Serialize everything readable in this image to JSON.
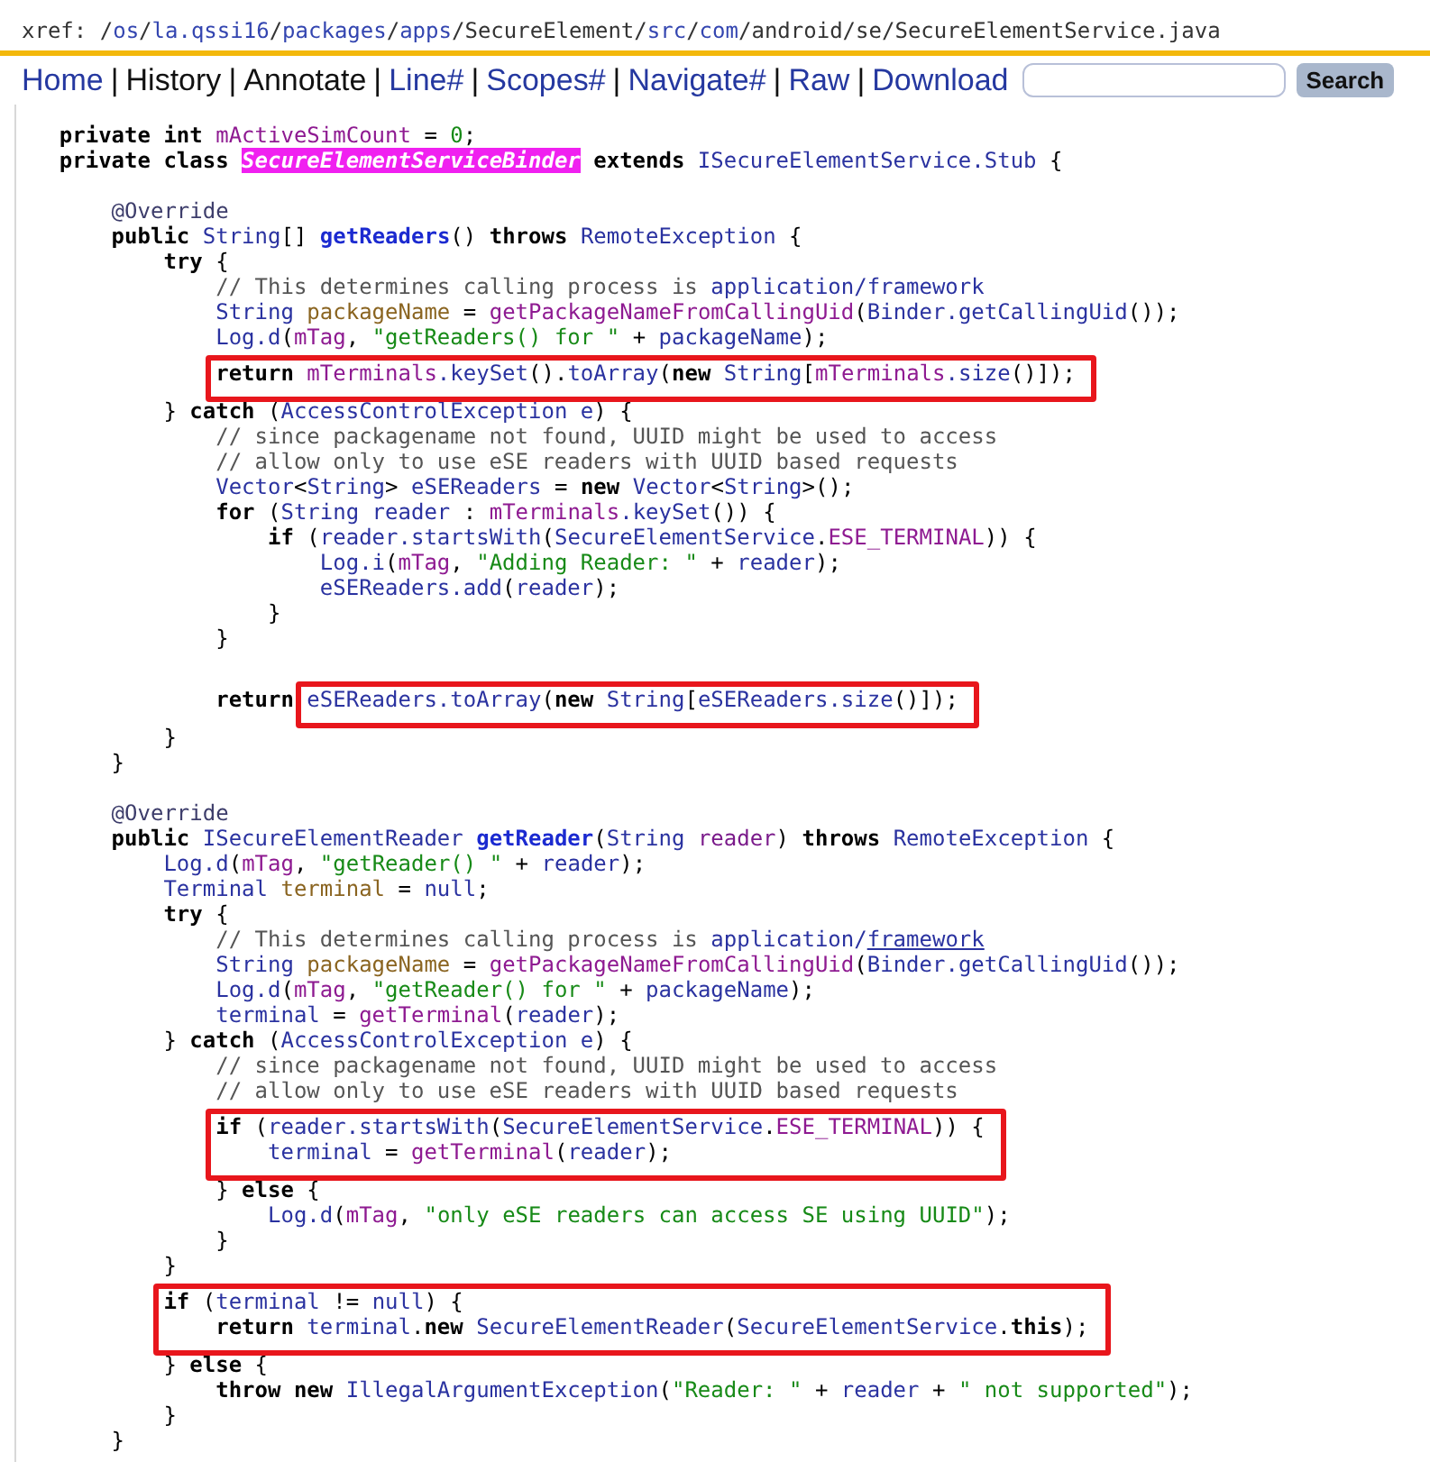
{
  "xref": {
    "label": "xref:",
    "separator": "/",
    "segments": [
      {
        "text": "os",
        "visited": false
      },
      {
        "text": "la.qssi16",
        "visited": false
      },
      {
        "text": "packages",
        "visited": false
      },
      {
        "text": "apps",
        "visited": false
      },
      {
        "text": "SecureElement",
        "visited": true
      },
      {
        "text": "src",
        "visited": false
      },
      {
        "text": "com",
        "visited": false
      },
      {
        "text": "android",
        "visited": true
      },
      {
        "text": "se",
        "visited": true
      },
      {
        "text": "SecureElementService.java",
        "visited": true
      }
    ]
  },
  "nav": {
    "separator": "|",
    "items": [
      {
        "label": "Home",
        "visited": false
      },
      {
        "label": "History",
        "visited": true
      },
      {
        "label": "Annotate",
        "visited": true
      },
      {
        "label": "Line#",
        "visited": false
      },
      {
        "label": "Scopes#",
        "visited": false
      },
      {
        "label": "Navigate#",
        "visited": false
      },
      {
        "label": "Raw",
        "visited": false
      },
      {
        "label": "Download",
        "visited": false
      }
    ],
    "search_button": "Search"
  },
  "code_lines": [
    {
      "kind": "code",
      "tokens": [
        {
          "kind": "kw",
          "t": "    private int "
        },
        {
          "kind": "fld",
          "t": "mActiveSimCount"
        },
        {
          "kind": "p",
          "t": " = "
        },
        {
          "kind": "num",
          "t": "0"
        },
        {
          "kind": "p",
          "t": ";"
        }
      ]
    },
    {
      "kind": "code",
      "tokens": [
        {
          "kind": "kw",
          "t": "    private class "
        },
        {
          "kind": "hl",
          "t": "SecureElementServiceBinder"
        },
        {
          "kind": "kw",
          "t": " extends "
        },
        {
          "kind": "id",
          "t": "ISecureElementService.Stub"
        },
        {
          "kind": "p",
          "t": " {"
        }
      ]
    },
    {
      "kind": "blank"
    },
    {
      "kind": "code",
      "tokens": [
        {
          "kind": "ann",
          "t": "        @Override"
        }
      ]
    },
    {
      "kind": "code",
      "tokens": [
        {
          "kind": "kw",
          "t": "        public "
        },
        {
          "kind": "id",
          "t": "String"
        },
        {
          "kind": "p",
          "t": "[] "
        },
        {
          "kind": "def",
          "t": "getReaders"
        },
        {
          "kind": "p",
          "t": "() "
        },
        {
          "kind": "kw",
          "t": "throws "
        },
        {
          "kind": "id",
          "t": "RemoteException"
        },
        {
          "kind": "p",
          "t": " {"
        }
      ]
    },
    {
      "kind": "code",
      "tokens": [
        {
          "kind": "kw",
          "t": "            try"
        },
        {
          "kind": "p",
          "t": " {"
        }
      ]
    },
    {
      "kind": "code",
      "tokens": [
        {
          "kind": "com",
          "t": "                // This determines calling process is "
        },
        {
          "kind": "ref",
          "t": "application/framework"
        }
      ]
    },
    {
      "kind": "code",
      "tokens": [
        {
          "kind": "id",
          "t": "                String "
        },
        {
          "kind": "loc",
          "t": "packageName"
        },
        {
          "kind": "p",
          "t": " = "
        },
        {
          "kind": "fld",
          "t": "getPackageNameFromCallingUid"
        },
        {
          "kind": "p",
          "t": "("
        },
        {
          "kind": "id",
          "t": "Binder.getCallingUid"
        },
        {
          "kind": "p",
          "t": "());"
        }
      ]
    },
    {
      "kind": "code",
      "tokens": [
        {
          "kind": "id",
          "t": "                Log.d"
        },
        {
          "kind": "p",
          "t": "("
        },
        {
          "kind": "fld",
          "t": "mTag"
        },
        {
          "kind": "p",
          "t": ", "
        },
        {
          "kind": "str",
          "t": "\"getReaders() for \""
        },
        {
          "kind": "p",
          "t": " + "
        },
        {
          "kind": "id",
          "t": "packageName"
        },
        {
          "kind": "p",
          "t": ");"
        }
      ]
    },
    {
      "kind": "code",
      "boxed": true,
      "tokens": [
        {
          "kind": "kw",
          "t": "                return "
        },
        {
          "kind": "fld",
          "t": "mTerminals"
        },
        {
          "kind": "id",
          "t": ".keySet"
        },
        {
          "kind": "p",
          "t": "()."
        },
        {
          "kind": "id",
          "t": "toArray"
        },
        {
          "kind": "p",
          "t": "("
        },
        {
          "kind": "kw",
          "t": "new "
        },
        {
          "kind": "id",
          "t": "String"
        },
        {
          "kind": "p",
          "t": "["
        },
        {
          "kind": "fld",
          "t": "mTerminals"
        },
        {
          "kind": "id",
          "t": ".size"
        },
        {
          "kind": "p",
          "t": "()]);"
        }
      ]
    },
    {
      "kind": "code",
      "tokens": [
        {
          "kind": "p",
          "t": "            } "
        },
        {
          "kind": "kw",
          "t": "catch"
        },
        {
          "kind": "p",
          "t": " ("
        },
        {
          "kind": "id",
          "t": "AccessControlException e"
        },
        {
          "kind": "p",
          "t": ") {"
        }
      ]
    },
    {
      "kind": "code",
      "tokens": [
        {
          "kind": "com",
          "t": "                // since packagename not found, UUID might be used to access"
        }
      ]
    },
    {
      "kind": "code",
      "tokens": [
        {
          "kind": "com",
          "t": "                // allow only to use eSE readers with UUID based requests"
        }
      ]
    },
    {
      "kind": "code",
      "tokens": [
        {
          "kind": "id",
          "t": "                Vector"
        },
        {
          "kind": "p",
          "t": "<"
        },
        {
          "kind": "id",
          "t": "String"
        },
        {
          "kind": "p",
          "t": "> "
        },
        {
          "kind": "id",
          "t": "eSEReaders"
        },
        {
          "kind": "p",
          "t": " = "
        },
        {
          "kind": "kw",
          "t": "new "
        },
        {
          "kind": "id",
          "t": "Vector"
        },
        {
          "kind": "p",
          "t": "<"
        },
        {
          "kind": "id",
          "t": "String"
        },
        {
          "kind": "p",
          "t": ">();"
        }
      ]
    },
    {
      "kind": "code",
      "tokens": [
        {
          "kind": "kw",
          "t": "                for"
        },
        {
          "kind": "p",
          "t": " ("
        },
        {
          "kind": "id",
          "t": "String reader"
        },
        {
          "kind": "p",
          "t": " : "
        },
        {
          "kind": "fld",
          "t": "mTerminals"
        },
        {
          "kind": "id",
          "t": ".keySet"
        },
        {
          "kind": "p",
          "t": "()) {"
        }
      ]
    },
    {
      "kind": "code",
      "tokens": [
        {
          "kind": "kw",
          "t": "                    if"
        },
        {
          "kind": "p",
          "t": " ("
        },
        {
          "kind": "id",
          "t": "reader.startsWith"
        },
        {
          "kind": "p",
          "t": "("
        },
        {
          "kind": "id",
          "t": "SecureElementService"
        },
        {
          "kind": "p",
          "t": "."
        },
        {
          "kind": "fld",
          "t": "ESE_TERMINAL"
        },
        {
          "kind": "p",
          "t": ")) {"
        }
      ]
    },
    {
      "kind": "code",
      "tokens": [
        {
          "kind": "id",
          "t": "                        Log.i"
        },
        {
          "kind": "p",
          "t": "("
        },
        {
          "kind": "fld",
          "t": "mTag"
        },
        {
          "kind": "p",
          "t": ", "
        },
        {
          "kind": "str",
          "t": "\"Adding Reader: \""
        },
        {
          "kind": "p",
          "t": " + "
        },
        {
          "kind": "id",
          "t": "reader"
        },
        {
          "kind": "p",
          "t": ");"
        }
      ]
    },
    {
      "kind": "code",
      "tokens": [
        {
          "kind": "id",
          "t": "                        eSEReaders.add"
        },
        {
          "kind": "p",
          "t": "("
        },
        {
          "kind": "id",
          "t": "reader"
        },
        {
          "kind": "p",
          "t": ");"
        }
      ]
    },
    {
      "kind": "code",
      "tokens": [
        {
          "kind": "p",
          "t": "                    }"
        }
      ]
    },
    {
      "kind": "code",
      "tokens": [
        {
          "kind": "p",
          "t": "                }"
        }
      ]
    },
    {
      "kind": "blank"
    },
    {
      "kind": "code",
      "boxed": true,
      "tokens": [
        {
          "kind": "kw",
          "t": "                return "
        },
        {
          "kind": "id",
          "t": "eSEReaders.toArray",
          "box_edge": true
        },
        {
          "kind": "p",
          "t": "("
        },
        {
          "kind": "kw",
          "t": "new "
        },
        {
          "kind": "id",
          "t": "String"
        },
        {
          "kind": "p",
          "t": "["
        },
        {
          "kind": "id",
          "t": "eSEReaders.size"
        },
        {
          "kind": "p",
          "t": "()]);"
        }
      ]
    },
    {
      "kind": "code",
      "tokens": [
        {
          "kind": "p",
          "t": "            }"
        }
      ]
    },
    {
      "kind": "code",
      "tokens": [
        {
          "kind": "p",
          "t": "        }"
        }
      ]
    },
    {
      "kind": "blank"
    },
    {
      "kind": "code",
      "tokens": [
        {
          "kind": "ann",
          "t": "        @Override"
        }
      ]
    },
    {
      "kind": "code",
      "tokens": [
        {
          "kind": "kw",
          "t": "        public "
        },
        {
          "kind": "id",
          "t": "ISecureElementReader "
        },
        {
          "kind": "def",
          "t": "getReader"
        },
        {
          "kind": "p",
          "t": "("
        },
        {
          "kind": "id",
          "t": "String "
        },
        {
          "kind": "par",
          "t": "reader"
        },
        {
          "kind": "p",
          "t": ") "
        },
        {
          "kind": "kw",
          "t": "throws "
        },
        {
          "kind": "id",
          "t": "RemoteException"
        },
        {
          "kind": "p",
          "t": " {"
        }
      ]
    },
    {
      "kind": "code",
      "tokens": [
        {
          "kind": "id",
          "t": "            Log.d"
        },
        {
          "kind": "p",
          "t": "("
        },
        {
          "kind": "fld",
          "t": "mTag"
        },
        {
          "kind": "p",
          "t": ", "
        },
        {
          "kind": "str",
          "t": "\"getReader() \""
        },
        {
          "kind": "p",
          "t": " + "
        },
        {
          "kind": "id",
          "t": "reader"
        },
        {
          "kind": "p",
          "t": ");"
        }
      ]
    },
    {
      "kind": "code",
      "tokens": [
        {
          "kind": "id",
          "t": "            Terminal "
        },
        {
          "kind": "loc",
          "t": "terminal"
        },
        {
          "kind": "p",
          "t": " = "
        },
        {
          "kind": "id",
          "t": "null"
        },
        {
          "kind": "p",
          "t": ";"
        }
      ]
    },
    {
      "kind": "code",
      "tokens": [
        {
          "kind": "kw",
          "t": "            try"
        },
        {
          "kind": "p",
          "t": " {"
        }
      ]
    },
    {
      "kind": "code",
      "tokens": [
        {
          "kind": "com",
          "t": "                // This determines calling process is "
        },
        {
          "kind": "ref",
          "t": "application/"
        },
        {
          "kind": "refu",
          "t": "framework"
        }
      ]
    },
    {
      "kind": "code",
      "tokens": [
        {
          "kind": "id",
          "t": "                String "
        },
        {
          "kind": "loc",
          "t": "packageName"
        },
        {
          "kind": "p",
          "t": " = "
        },
        {
          "kind": "fld",
          "t": "getPackageNameFromCallingUid"
        },
        {
          "kind": "p",
          "t": "("
        },
        {
          "kind": "id",
          "t": "Binder.getCallingUid"
        },
        {
          "kind": "p",
          "t": "());"
        }
      ]
    },
    {
      "kind": "code",
      "tokens": [
        {
          "kind": "id",
          "t": "                Log.d"
        },
        {
          "kind": "p",
          "t": "("
        },
        {
          "kind": "fld",
          "t": "mTag"
        },
        {
          "kind": "p",
          "t": ", "
        },
        {
          "kind": "str",
          "t": "\"getReader() for \""
        },
        {
          "kind": "p",
          "t": " + "
        },
        {
          "kind": "id",
          "t": "packageName"
        },
        {
          "kind": "p",
          "t": ");"
        }
      ]
    },
    {
      "kind": "code",
      "tokens": [
        {
          "kind": "id",
          "t": "                terminal"
        },
        {
          "kind": "p",
          "t": " = "
        },
        {
          "kind": "fld",
          "t": "getTerminal"
        },
        {
          "kind": "p",
          "t": "("
        },
        {
          "kind": "id",
          "t": "reader"
        },
        {
          "kind": "p",
          "t": ");"
        }
      ]
    },
    {
      "kind": "code",
      "tokens": [
        {
          "kind": "p",
          "t": "            } "
        },
        {
          "kind": "kw",
          "t": "catch"
        },
        {
          "kind": "p",
          "t": " ("
        },
        {
          "kind": "id",
          "t": "AccessControlException e"
        },
        {
          "kind": "p",
          "t": ") {"
        }
      ]
    },
    {
      "kind": "code",
      "tokens": [
        {
          "kind": "com",
          "t": "                // since packagename not found, UUID might be used to access"
        }
      ]
    },
    {
      "kind": "code",
      "tokens": [
        {
          "kind": "com",
          "t": "                // allow only to use eSE readers with UUID based requests"
        }
      ]
    },
    {
      "kind": "code",
      "boxed": true,
      "tokens": [
        {
          "kind": "kw",
          "t": "                if"
        },
        {
          "kind": "p",
          "t": " ("
        },
        {
          "kind": "id",
          "t": "reader.startsWith"
        },
        {
          "kind": "p",
          "t": "("
        },
        {
          "kind": "id",
          "t": "SecureElementService"
        },
        {
          "kind": "p",
          "t": "."
        },
        {
          "kind": "fld",
          "t": "ESE_TERMINAL"
        },
        {
          "kind": "p",
          "t": ")) {"
        }
      ]
    },
    {
      "kind": "code",
      "boxed": true,
      "tokens": [
        {
          "kind": "id",
          "t": "                    terminal"
        },
        {
          "kind": "p",
          "t": " = "
        },
        {
          "kind": "fld",
          "t": "getTerminal"
        },
        {
          "kind": "p",
          "t": "("
        },
        {
          "kind": "id",
          "t": "reader"
        },
        {
          "kind": "p",
          "t": ");"
        }
      ]
    },
    {
      "kind": "code",
      "tokens": [
        {
          "kind": "p",
          "t": "                } "
        },
        {
          "kind": "kw",
          "t": "else"
        },
        {
          "kind": "p",
          "t": " {"
        }
      ]
    },
    {
      "kind": "code",
      "tokens": [
        {
          "kind": "id",
          "t": "                    Log.d"
        },
        {
          "kind": "p",
          "t": "("
        },
        {
          "kind": "fld",
          "t": "mTag"
        },
        {
          "kind": "p",
          "t": ", "
        },
        {
          "kind": "str",
          "t": "\"only eSE readers can access SE using UUID\""
        },
        {
          "kind": "p",
          "t": ");"
        }
      ]
    },
    {
      "kind": "code",
      "tokens": [
        {
          "kind": "p",
          "t": "                }"
        }
      ]
    },
    {
      "kind": "code",
      "tokens": [
        {
          "kind": "p",
          "t": "            }"
        }
      ]
    },
    {
      "kind": "code",
      "boxed": true,
      "tokens": [
        {
          "kind": "kw",
          "t": "            if"
        },
        {
          "kind": "p",
          "t": " ("
        },
        {
          "kind": "id",
          "t": "terminal"
        },
        {
          "kind": "p",
          "t": " != "
        },
        {
          "kind": "id",
          "t": "null"
        },
        {
          "kind": "p",
          "t": ") {"
        }
      ]
    },
    {
      "kind": "code",
      "boxed": true,
      "tokens": [
        {
          "kind": "kw",
          "t": "                return "
        },
        {
          "kind": "id",
          "t": "terminal"
        },
        {
          "kind": "p",
          "t": "."
        },
        {
          "kind": "kw",
          "t": "new "
        },
        {
          "kind": "id",
          "t": "SecureElementReader"
        },
        {
          "kind": "p",
          "t": "("
        },
        {
          "kind": "id",
          "t": "SecureElementService"
        },
        {
          "kind": "p",
          "t": "."
        },
        {
          "kind": "kw",
          "t": "this"
        },
        {
          "kind": "p",
          "t": ");"
        }
      ]
    },
    {
      "kind": "code",
      "tokens": [
        {
          "kind": "p",
          "t": "            } "
        },
        {
          "kind": "kw",
          "t": "else"
        },
        {
          "kind": "p",
          "t": " {"
        }
      ]
    },
    {
      "kind": "code",
      "tokens": [
        {
          "kind": "kw",
          "t": "                throw new "
        },
        {
          "kind": "id",
          "t": "IllegalArgumentException"
        },
        {
          "kind": "p",
          "t": "("
        },
        {
          "kind": "str",
          "t": "\"Reader: \""
        },
        {
          "kind": "p",
          "t": " + "
        },
        {
          "kind": "id",
          "t": "reader"
        },
        {
          "kind": "p",
          "t": " + "
        },
        {
          "kind": "str",
          "t": "\" not supported\""
        },
        {
          "kind": "p",
          "t": ");"
        }
      ]
    },
    {
      "kind": "code",
      "tokens": [
        {
          "kind": "p",
          "t": "            }"
        }
      ]
    },
    {
      "kind": "code",
      "tokens": [
        {
          "kind": "p",
          "t": "        }"
        }
      ]
    }
  ]
}
